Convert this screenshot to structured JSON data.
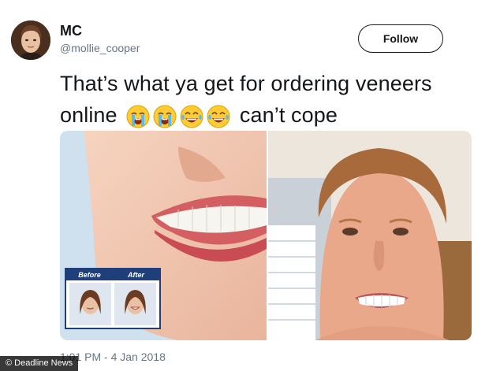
{
  "tweet": {
    "display_name": "MC",
    "handle": "@mollie_cooper",
    "follow_label": "Follow",
    "text_part1": "That’s what ya get for ordering veneers online",
    "emojis": [
      "loudly-crying-face",
      "loudly-crying-face",
      "tears-of-joy-face",
      "tears-of-joy-face"
    ],
    "text_part2": "can’t cope",
    "timestamp": "1:01 PM - 4 Jan 2018"
  },
  "media": {
    "left_image": {
      "subject": "smiling-mouth-closeup",
      "before_label": "Before",
      "after_label": "After"
    },
    "right_image": {
      "subject": "man-selfie-with-veneers"
    }
  },
  "watermark": "Deadline News",
  "colors": {
    "text": "#14171a",
    "secondary": "#657786",
    "badge": "#1f3f7a"
  }
}
